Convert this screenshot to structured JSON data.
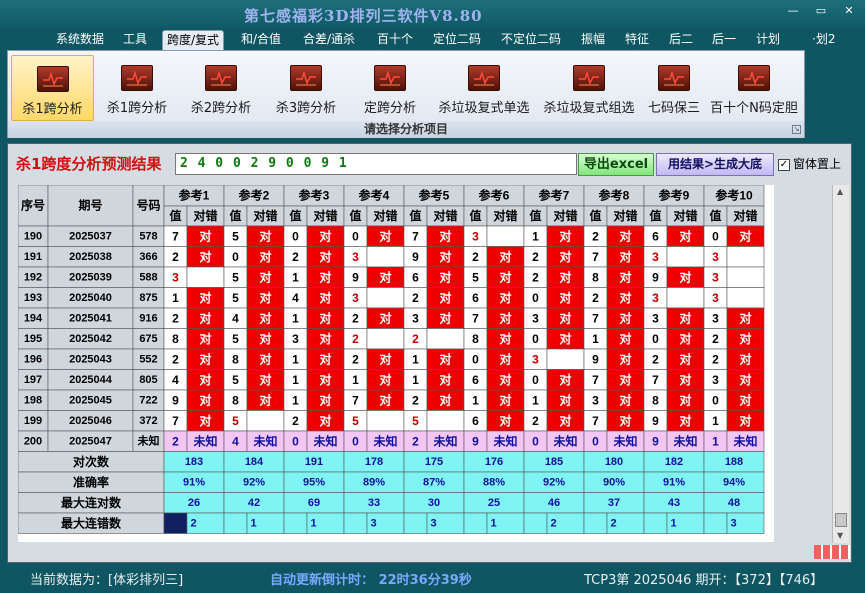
{
  "app": {
    "title": "第七感福彩3D排列三软件V8.80",
    "window_buttons": [
      "—",
      "▭",
      "✕"
    ]
  },
  "menu": [
    "系统数据",
    "工具",
    "跨度/复式",
    "和/合值",
    "合差/通杀",
    "百十个",
    "定位二码",
    "不定位二码",
    "振幅",
    "特征",
    "后二",
    "后一",
    "计划",
    "·划2"
  ],
  "menu_active": 2,
  "ribbon": {
    "buttons": [
      "杀1跨分析",
      "杀1跨分析",
      "杀2跨分析",
      "杀3跨分析",
      "定跨分析",
      "杀垃圾复式单选",
      "杀垃圾复式组选",
      "七码保三",
      "百十个N码定胆"
    ],
    "active": 0,
    "caption": "请选择分析项目"
  },
  "result": {
    "title": "杀1跨度分析预测结果",
    "value": "2 4 0 0 2 9 0 0 9 1",
    "export_button": "导出excel",
    "generate_button": "用结果>生成大底",
    "on_top_label": "窗体置上",
    "on_top_checked": true
  },
  "table": {
    "col_headers": [
      "序号",
      "期号",
      "号码"
    ],
    "ref_headers": [
      "参考1",
      "参考2",
      "参考3",
      "参考4",
      "参考5",
      "参考6",
      "参考7",
      "参考8",
      "参考9",
      "参考10"
    ],
    "sub_value": "值",
    "sub_result": "对错",
    "hit_text": "对",
    "rows": [
      {
        "seq": "190",
        "period": "2025037",
        "number": "578",
        "vals": [
          "7",
          "5",
          "0",
          "0",
          "7",
          "3",
          "1",
          "2",
          "6",
          "0"
        ],
        "hits": [
          1,
          1,
          1,
          1,
          1,
          0,
          1,
          1,
          1,
          1
        ]
      },
      {
        "seq": "191",
        "period": "2025038",
        "number": "366",
        "vals": [
          "2",
          "0",
          "2",
          "3",
          "9",
          "2",
          "2",
          "7",
          "3",
          "3"
        ],
        "hits": [
          1,
          1,
          1,
          0,
          1,
          1,
          1,
          1,
          0,
          0
        ]
      },
      {
        "seq": "192",
        "period": "2025039",
        "number": "588",
        "vals": [
          "3",
          "5",
          "1",
          "9",
          "6",
          "5",
          "2",
          "8",
          "9",
          "3"
        ],
        "hits": [
          0,
          1,
          1,
          1,
          1,
          1,
          1,
          1,
          1,
          0
        ]
      },
      {
        "seq": "193",
        "period": "2025040",
        "number": "875",
        "vals": [
          "1",
          "5",
          "4",
          "3",
          "2",
          "6",
          "0",
          "2",
          "3",
          "3"
        ],
        "hits": [
          1,
          1,
          1,
          0,
          1,
          1,
          1,
          1,
          0,
          0
        ]
      },
      {
        "seq": "194",
        "period": "2025041",
        "number": "916",
        "vals": [
          "2",
          "4",
          "1",
          "2",
          "3",
          "7",
          "3",
          "7",
          "3",
          "3"
        ],
        "hits": [
          1,
          1,
          1,
          1,
          1,
          1,
          1,
          1,
          1,
          1
        ]
      },
      {
        "seq": "195",
        "period": "2025042",
        "number": "675",
        "vals": [
          "8",
          "5",
          "3",
          "2",
          "2",
          "8",
          "0",
          "1",
          "0",
          "2"
        ],
        "hits": [
          1,
          1,
          1,
          0,
          0,
          1,
          1,
          1,
          1,
          1
        ]
      },
      {
        "seq": "196",
        "period": "2025043",
        "number": "552",
        "vals": [
          "2",
          "8",
          "1",
          "2",
          "1",
          "0",
          "3",
          "9",
          "2",
          "2"
        ],
        "hits": [
          1,
          1,
          1,
          1,
          1,
          1,
          0,
          1,
          1,
          1
        ]
      },
      {
        "seq": "197",
        "period": "2025044",
        "number": "805",
        "vals": [
          "4",
          "5",
          "1",
          "1",
          "1",
          "6",
          "0",
          "7",
          "7",
          "3"
        ],
        "hits": [
          1,
          1,
          1,
          1,
          1,
          1,
          1,
          1,
          1,
          1
        ]
      },
      {
        "seq": "198",
        "period": "2025045",
        "number": "722",
        "vals": [
          "9",
          "8",
          "1",
          "7",
          "2",
          "1",
          "1",
          "3",
          "8",
          "0"
        ],
        "hits": [
          1,
          1,
          1,
          1,
          1,
          1,
          1,
          1,
          1,
          1
        ]
      },
      {
        "seq": "199",
        "period": "2025046",
        "number": "372",
        "vals": [
          "7",
          "5",
          "2",
          "5",
          "5",
          "6",
          "2",
          "7",
          "9",
          "1"
        ],
        "hits": [
          1,
          0,
          1,
          0,
          0,
          1,
          1,
          1,
          1,
          1
        ]
      }
    ],
    "predict_row": {
      "seq": "200",
      "period": "2025047",
      "number": "未知",
      "vals": [
        "2",
        "4",
        "0",
        "0",
        "2",
        "9",
        "0",
        "0",
        "9",
        "1"
      ],
      "result": "未知"
    },
    "stats": [
      {
        "label": "对次数",
        "values": [
          "183",
          "184",
          "191",
          "178",
          "175",
          "176",
          "185",
          "180",
          "182",
          "188"
        ]
      },
      {
        "label": "准确率",
        "values": [
          "91%",
          "92%",
          "95%",
          "89%",
          "87%",
          "88%",
          "92%",
          "90%",
          "91%",
          "94%"
        ]
      },
      {
        "label": "最大连对数",
        "values": [
          "26",
          "42",
          "69",
          "33",
          "30",
          "25",
          "46",
          "37",
          "43",
          "48"
        ]
      },
      {
        "label": "最大连错数",
        "values": [
          "2",
          "1",
          "1",
          "3",
          "3",
          "1",
          "2",
          "2",
          "1",
          "3"
        ]
      }
    ]
  },
  "status": {
    "data_label": "当前数据为：[体彩排列三]",
    "countdown": "自动更新倒计时：  22时36分39秒",
    "draw_info": "TCP3第 2025046 期开：【372】【746】"
  },
  "colors": {
    "hit": "#ee0000",
    "predict_bg": "#f4c6f4",
    "stats_bg": "#80f4f4",
    "header_bg": "#cfd6dc",
    "title_red": "#d01010"
  }
}
